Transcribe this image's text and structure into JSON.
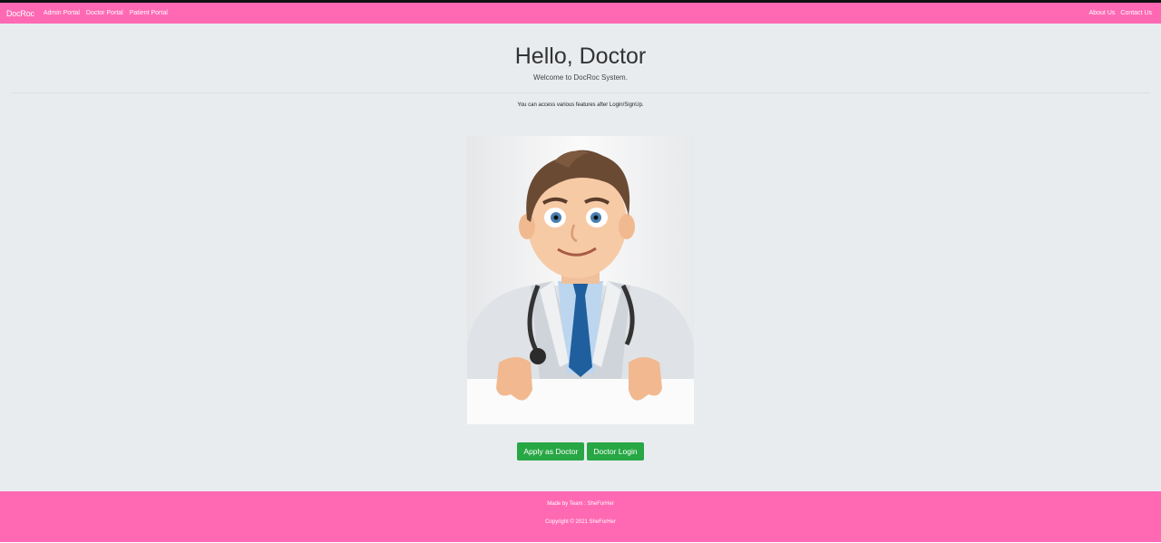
{
  "navbar": {
    "brand": "DocRoc",
    "links": [
      "Admin Portal",
      "Doctor Portal",
      "Patient Portal"
    ],
    "right_links": [
      "About Us",
      "Contact Us"
    ]
  },
  "hero": {
    "title": "Hello, Doctor",
    "subtitle": "Welcome to DocRoc System.",
    "info": "You can access various features after Login/SignUp."
  },
  "image": {
    "name": "doctor-cartoon"
  },
  "buttons": {
    "apply": "Apply as Doctor",
    "login": "Doctor Login"
  },
  "footer": {
    "made_by": "Made by Team : SheForHer",
    "copyright": "Copyright © 2021 SheForHer"
  },
  "colors": {
    "brand_pink": "#ff69b4",
    "button_green": "#28a745",
    "background": "#e9ecef"
  }
}
